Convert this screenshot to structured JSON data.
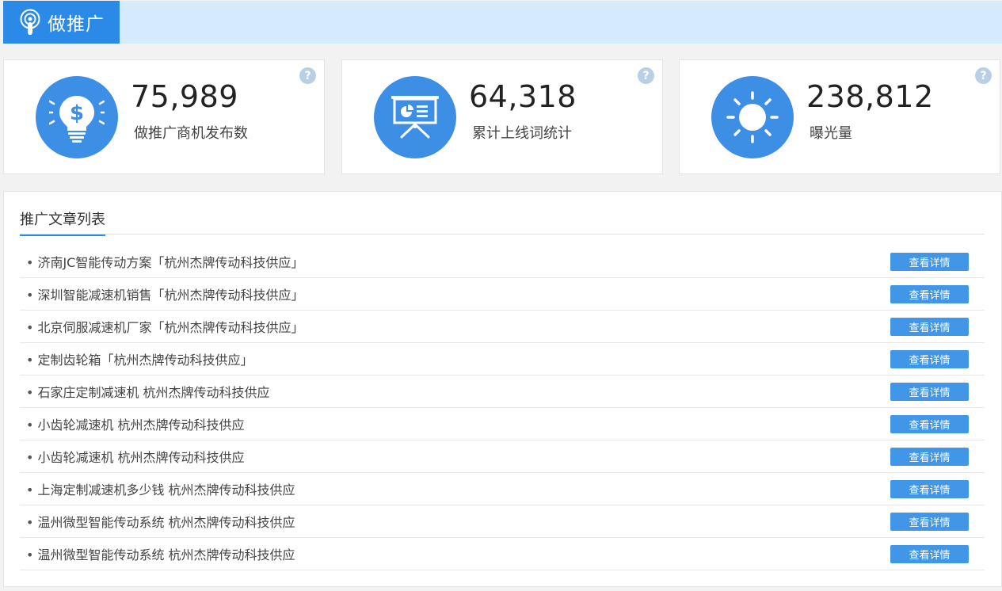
{
  "header": {
    "title": "做推广",
    "icon": "podcast-icon"
  },
  "stats": [
    {
      "value": "75,989",
      "label": "做推广商机发布数",
      "icon": "money-bulb-icon",
      "help": "?"
    },
    {
      "value": "64,318",
      "label": "累计上线词统计",
      "icon": "presentation-board-icon",
      "help": "?"
    },
    {
      "value": "238,812",
      "label": "曝光量",
      "icon": "sun-icon",
      "help": "?"
    }
  ],
  "articles": {
    "title": "推广文章列表",
    "button_label": "查看详情",
    "items": [
      "济南JC智能传动方案「杭州杰牌传动科技供应」",
      "深圳智能减速机销售「杭州杰牌传动科技供应」",
      "北京伺服减速机厂家「杭州杰牌传动科技供应」",
      "定制齿轮箱「杭州杰牌传动科技供应」",
      "石家庄定制减速机 杭州杰牌传动科技供应",
      "小齿轮减速机 杭州杰牌传动科技供应",
      "小齿轮减速机 杭州杰牌传动科技供应",
      "上海定制减速机多少钱 杭州杰牌传动科技供应",
      "温州微型智能传动系统 杭州杰牌传动科技供应",
      "温州微型智能传动系统 杭州杰牌传动科技供应"
    ]
  },
  "colors": {
    "accent": "#2b8ae8",
    "button": "#4196e8",
    "circle": "#3d8fe6",
    "topbar": "#d6eafd"
  }
}
